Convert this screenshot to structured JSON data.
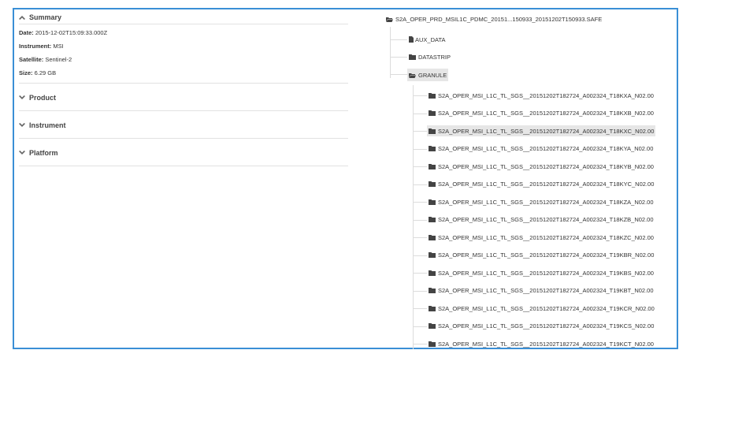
{
  "summary": {
    "title": "Summary",
    "date_label": "Date:",
    "date_value": "2015-12-02T15:09:33.000Z",
    "instrument_label": "Instrument:",
    "instrument_value": "MSI",
    "satellite_label": "Satellite:",
    "satellite_value": "Sentinel-2",
    "size_label": "Size:",
    "size_value": "6.29 GB"
  },
  "sections": {
    "product": "Product",
    "instrument": "Instrument",
    "platform": "Platform"
  },
  "tree": {
    "root": "S2A_OPER_PRD_MSIL1C_PDMC_20151...150933_20151202T150933.SAFE",
    "aux": "AUX_DATA",
    "datastrip": "DATASTRIP",
    "granule": "GRANULE",
    "granules": [
      "S2A_OPER_MSI_L1C_TL_SGS__20151202T182724_A002324_T18KXA_N02.00",
      "S2A_OPER_MSI_L1C_TL_SGS__20151202T182724_A002324_T18KXB_N02.00",
      "S2A_OPER_MSI_L1C_TL_SGS__20151202T182724_A002324_T18KXC_N02.00",
      "S2A_OPER_MSI_L1C_TL_SGS__20151202T182724_A002324_T18KYA_N02.00",
      "S2A_OPER_MSI_L1C_TL_SGS__20151202T182724_A002324_T18KYB_N02.00",
      "S2A_OPER_MSI_L1C_TL_SGS__20151202T182724_A002324_T18KYC_N02.00",
      "S2A_OPER_MSI_L1C_TL_SGS__20151202T182724_A002324_T18KZA_N02.00",
      "S2A_OPER_MSI_L1C_TL_SGS__20151202T182724_A002324_T18KZB_N02.00",
      "S2A_OPER_MSI_L1C_TL_SGS__20151202T182724_A002324_T18KZC_N02.00",
      "S2A_OPER_MSI_L1C_TL_SGS__20151202T182724_A002324_T19KBR_N02.00",
      "S2A_OPER_MSI_L1C_TL_SGS__20151202T182724_A002324_T19KBS_N02.00",
      "S2A_OPER_MSI_L1C_TL_SGS__20151202T182724_A002324_T19KBT_N02.00",
      "S2A_OPER_MSI_L1C_TL_SGS__20151202T182724_A002324_T19KCR_N02.00",
      "S2A_OPER_MSI_L1C_TL_SGS__20151202T182724_A002324_T19KCS_N02.00",
      "S2A_OPER_MSI_L1C_TL_SGS__20151202T182724_A002324_T19KCT_N02.00"
    ],
    "selected_index": 2
  },
  "colors": {
    "frame_border": "#3a8fd6",
    "selected_bg": "#e6e6e6"
  },
  "icons": {
    "expanded": "chevron-up-icon",
    "collapsed": "chevron-down-icon",
    "folder_open": "folder-open-icon",
    "folder": "folder-icon",
    "file": "file-icon"
  }
}
